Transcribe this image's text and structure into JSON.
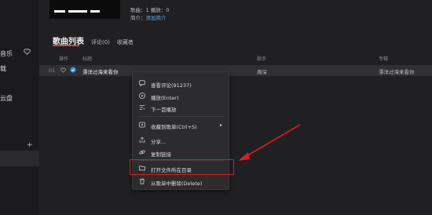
{
  "sidebar": {
    "items": [
      {
        "label": "音乐"
      },
      {
        "label": "载"
      },
      {
        "label": "云盘"
      }
    ]
  },
  "header": {
    "meta_line1": "歌曲：1   播放：0",
    "meta_line2_label": "简介：",
    "meta_line2_link": "添加简介"
  },
  "tabs": [
    {
      "label": "歌曲列表",
      "active": true
    },
    {
      "label": "评论(0)",
      "active": false
    },
    {
      "label": "收藏者",
      "active": false
    }
  ],
  "table": {
    "headers": {
      "op": "操作",
      "title": "标题",
      "artist": "歌手",
      "album": "专辑"
    },
    "rows": [
      {
        "index": "01",
        "title": "漂洋过海来看你",
        "artist": "周深",
        "album": "漂洋过海来看你"
      }
    ]
  },
  "context_menu": {
    "items": [
      {
        "label": "查看评论(91237)",
        "icon": "comment-icon"
      },
      {
        "label": "播放(Enter)",
        "icon": "play-icon"
      },
      {
        "label": "下一首播放",
        "icon": "next-play-icon"
      },
      {
        "label": "收藏到歌单(Ctrl+S)",
        "icon": "collect-icon"
      },
      {
        "label": "分享...",
        "icon": "share-icon"
      },
      {
        "label": "复制链接",
        "icon": "link-icon"
      },
      {
        "label": "打开文件所在目录",
        "icon": "folder-icon"
      },
      {
        "label": "从歌单中删除(Delete)",
        "icon": "trash-icon"
      }
    ]
  },
  "colors": {
    "accent": "#e03b3b",
    "annotation": "#d61f1f",
    "link": "#6aa6e0"
  }
}
